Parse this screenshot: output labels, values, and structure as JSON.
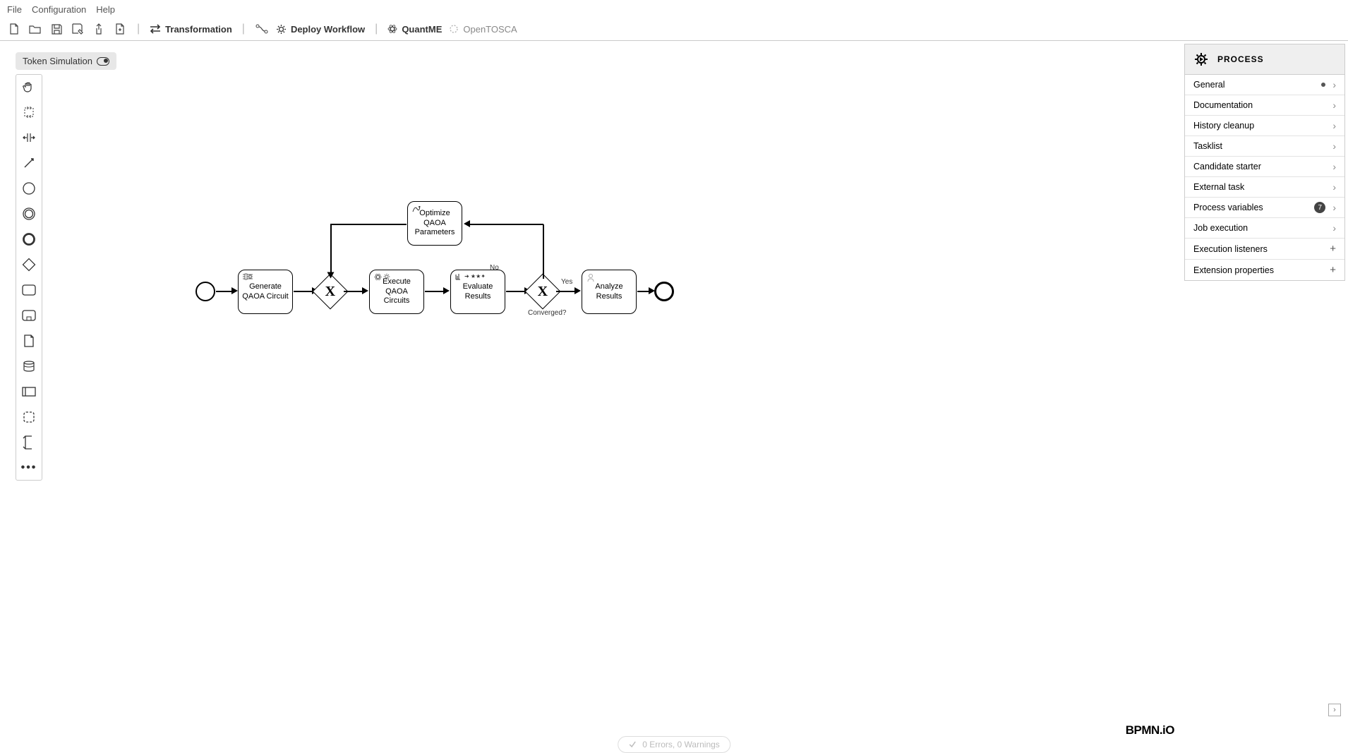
{
  "menu": {
    "file": "File",
    "config": "Configuration",
    "help": "Help"
  },
  "toolbar": {
    "transformation": "Transformation",
    "deploy": "Deploy Workflow",
    "quantme": "QuantME",
    "opentosca": "OpenTOSCA"
  },
  "tokenSim": "Token Simulation",
  "diagram": {
    "tasks": {
      "generate": "Generate QAOA Circuit",
      "optimize": "Optimize QAOA Parameters",
      "execute": "Execute QAOA Circuits",
      "evaluate": "Evaluate Results",
      "analyze": "Analyze Results"
    },
    "gateway_label": "Converged?",
    "flow_yes": "Yes",
    "flow_no": "No"
  },
  "panel": {
    "header": "PROCESS",
    "rows": {
      "general": "General",
      "documentation": "Documentation",
      "history": "History cleanup",
      "tasklist": "Tasklist",
      "candidate": "Candidate starter",
      "external": "External task",
      "procvars": "Process variables",
      "procvars_badge": "7",
      "jobexec": "Job execution",
      "exec_listeners": "Execution listeners",
      "ext_props": "Extension properties"
    }
  },
  "status": "0 Errors, 0 Warnings",
  "brand": "BPMN.iO"
}
